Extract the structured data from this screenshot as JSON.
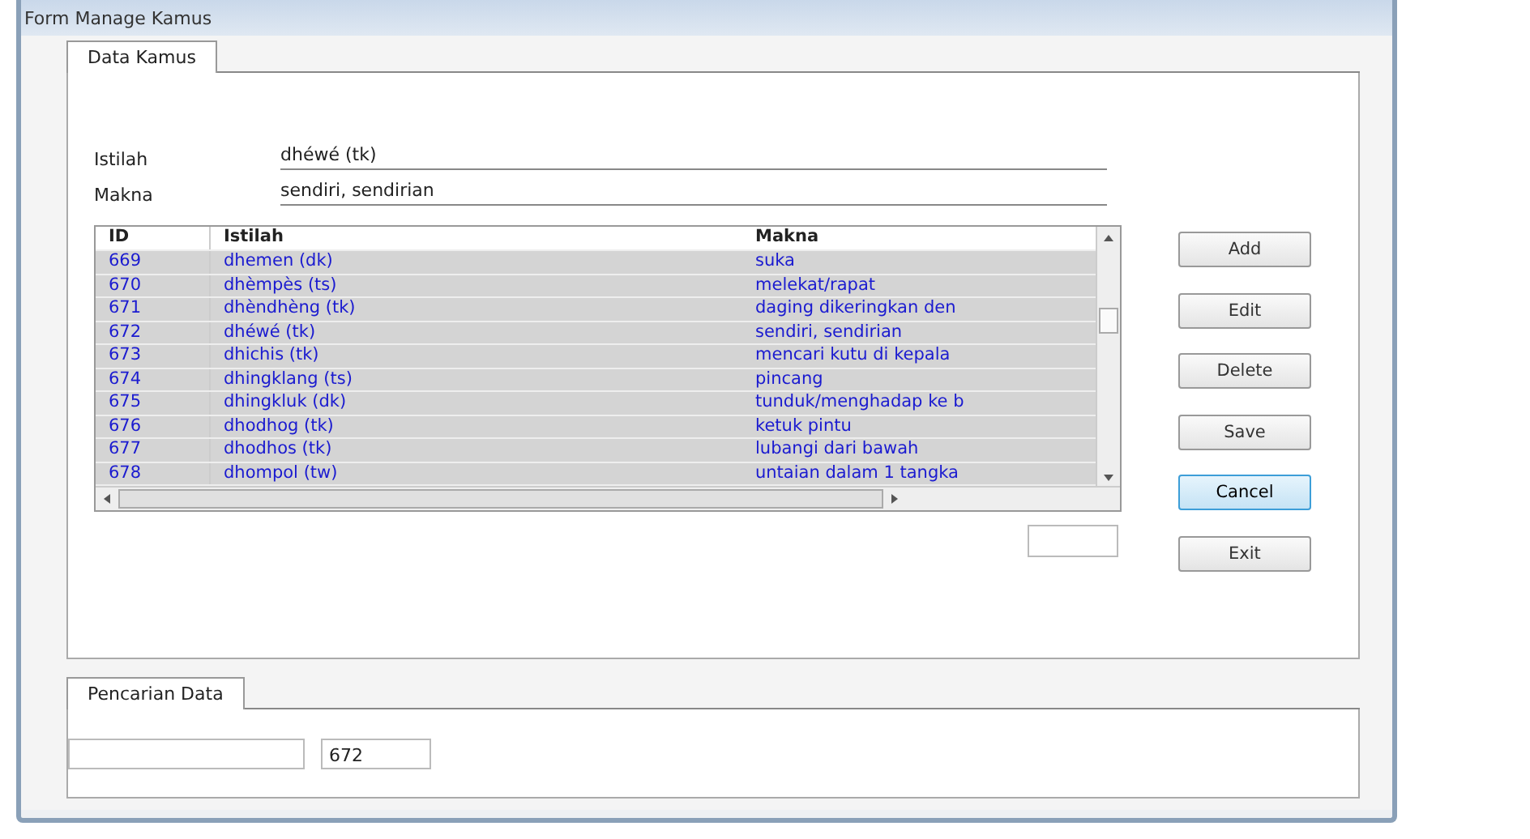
{
  "window": {
    "title": "Form Manage Kamus"
  },
  "main_tab": {
    "label": "Data Kamus",
    "selected": true
  },
  "fields": [
    {
      "label": "Istilah",
      "value": "dhéwé (tk)"
    },
    {
      "label": "Makna",
      "value": "sendiri, sendirian"
    }
  ],
  "table": {
    "columns": [
      "ID",
      "Istilah",
      "Makna"
    ],
    "rows": [
      {
        "cells": [
          "669",
          "dhemen (dk)",
          "suka"
        ]
      },
      {
        "cells": [
          "670",
          "dhèmpès (ts)",
          "melekat/rapat"
        ]
      },
      {
        "cells": [
          "671",
          "dhèndhèng (tk)",
          "daging dikeringkan den"
        ]
      },
      {
        "cells": [
          "672",
          "dhéwé (tk)",
          "sendiri, sendirian"
        ]
      },
      {
        "cells": [
          "673",
          "dhichis (tk)",
          "mencari kutu di kepala"
        ]
      },
      {
        "cells": [
          "674",
          "dhingklang (ts)",
          "pincang"
        ]
      },
      {
        "cells": [
          "675",
          "dhingkluk (dk)",
          "tunduk/menghadap ke b"
        ]
      },
      {
        "cells": [
          "676",
          "dhodhog (tk)",
          "ketuk pintu"
        ]
      },
      {
        "cells": [
          "677",
          "dhodhos (tk)",
          "lubangi dari bawah"
        ]
      },
      {
        "cells": [
          "678",
          "dhompol (tw)",
          "untaian dalam 1 tangka"
        ]
      }
    ]
  },
  "buttons": [
    {
      "label": "Add",
      "focused": false
    },
    {
      "label": "Edit",
      "focused": false
    },
    {
      "label": "Delete",
      "focused": false
    },
    {
      "label": "Save",
      "focused": false
    },
    {
      "label": "Cancel",
      "focused": true
    },
    {
      "label": "Exit",
      "focused": false
    }
  ],
  "search_tab": {
    "label": "Pencarian Data",
    "selected": true
  },
  "search_id_field": {
    "value": "672"
  }
}
